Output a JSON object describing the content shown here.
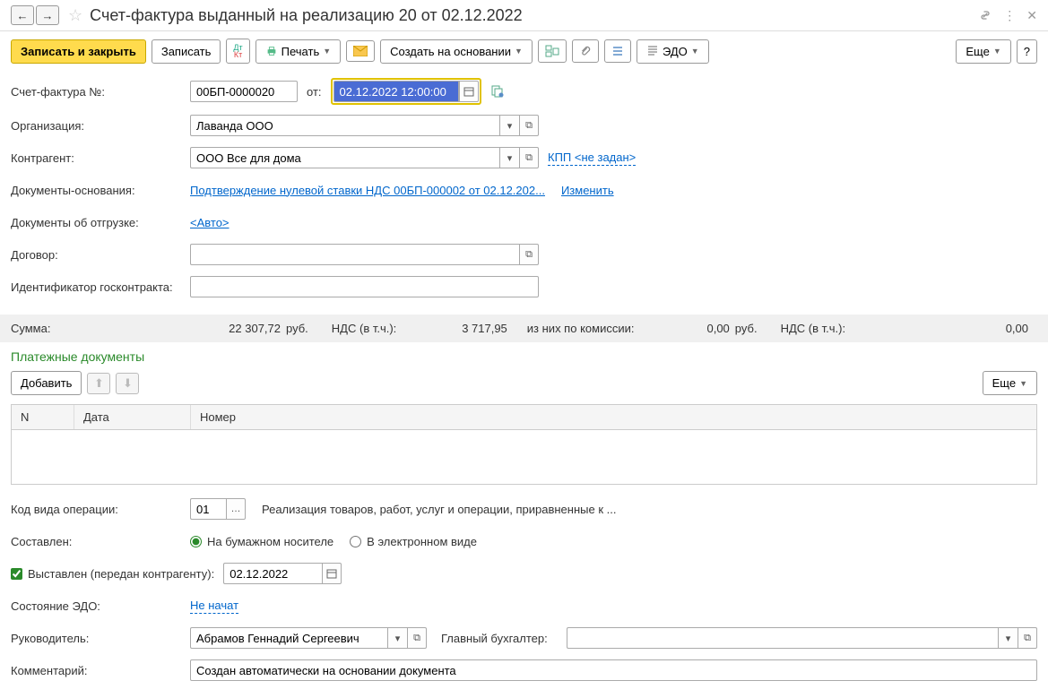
{
  "title": "Счет-фактура выданный на реализацию 20 от 02.12.2022",
  "toolbar": {
    "save_close": "Записать и закрыть",
    "save": "Записать",
    "print": "Печать",
    "create_based": "Создать на основании",
    "edo": "ЭДО",
    "more": "Еще"
  },
  "fields": {
    "invoice_no_label": "Счет-фактура №:",
    "invoice_no": "00БП-0000020",
    "from_label": "от:",
    "date": "02.12.2022 12:00:00",
    "org_label": "Организация:",
    "org": "Лаванда ООО",
    "counterparty_label": "Контрагент:",
    "counterparty": "ООО Все для дома",
    "kpp_link": "КПП <не задан>",
    "basis_docs_label": "Документы-основания:",
    "basis_docs_link": "Подтверждение нулевой ставки НДС 00БП-000002 от 02.12.202...",
    "change_link": "Изменить",
    "shipment_docs_label": "Документы об отгрузке:",
    "shipment_link": "<Авто>",
    "contract_label": "Договор:",
    "gov_contract_label": "Идентификатор госконтракта:"
  },
  "sums": {
    "sum_label": "Сумма:",
    "sum": "22 307,72",
    "cur": "руб.",
    "vat_label": "НДС (в т.ч.):",
    "vat": "3 717,95",
    "commission_label": "из них по комиссии:",
    "commission": "0,00",
    "cur2": "руб.",
    "vat2_label": "НДС (в т.ч.):",
    "vat2": "0,00"
  },
  "payment_docs": {
    "title": "Платежные документы",
    "add": "Добавить",
    "more": "Еще",
    "col_n": "N",
    "col_date": "Дата",
    "col_num": "Номер"
  },
  "bottom": {
    "op_code_label": "Код вида операции:",
    "op_code": "01",
    "op_desc": "Реализация товаров, работ, услуг и операции, приравненные к ...",
    "composed_label": "Составлен:",
    "paper": "На бумажном носителе",
    "electronic": "В электронном виде",
    "issued_label": "Выставлен (передан контрагенту):",
    "issued_date": "02.12.2022",
    "edo_state_label": "Состояние ЭДО:",
    "edo_state": "Не начат",
    "director_label": "Руководитель:",
    "director": "Абрамов Геннадий Сергеевич",
    "accountant_label": "Главный бухгалтер:",
    "comment_label": "Комментарий:",
    "comment": "Создан автоматически на основании документа"
  }
}
